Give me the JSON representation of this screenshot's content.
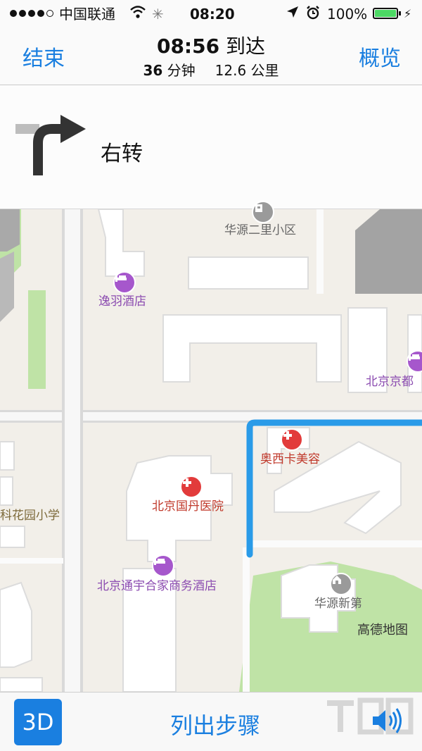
{
  "status_bar": {
    "carrier": "中国联通",
    "time": "08:20",
    "battery": "100%",
    "signal_bars": 4,
    "signal_max": 5,
    "battery_level": 1.0,
    "battery_color": "#4cd964"
  },
  "header": {
    "end_label": "结束",
    "overview_label": "概览",
    "arrival_time": "08:56",
    "arrival_word": "到达",
    "duration_value": "36",
    "duration_unit": "分钟",
    "distance_value": "12.6",
    "distance_unit": "公里",
    "accent_color": "#1a7fe0"
  },
  "instruction": {
    "icon": "turn-right-arrow-icon",
    "text": "右转"
  },
  "map": {
    "pois": [
      {
        "name": "华源二里小区",
        "icon": "building-icon",
        "color": "gray"
      },
      {
        "name": "逸羽酒店",
        "icon": "hotel-bed-icon",
        "color": "purple"
      },
      {
        "name": "北京京都",
        "icon": "hotel-bed-icon",
        "color": "purple"
      },
      {
        "name": "奥西卡美容",
        "icon": "medical-cross-icon",
        "color": "red"
      },
      {
        "name": "北京国丹医院",
        "icon": "medical-cross-icon",
        "color": "red"
      },
      {
        "name": "科花园小学",
        "icon": "",
        "color": "brown"
      },
      {
        "name": "北京通宇合家商务酒店",
        "icon": "hotel-bed-icon",
        "color": "purple"
      },
      {
        "name": "华源新第",
        "icon": "house-icon",
        "color": "gray"
      }
    ],
    "attribution": "高德地图",
    "route_color": "#2a9be8"
  },
  "toolbar": {
    "btn_3d": "3D",
    "list_steps": "列出步骤",
    "volume_icon": "speaker-volume-icon"
  }
}
